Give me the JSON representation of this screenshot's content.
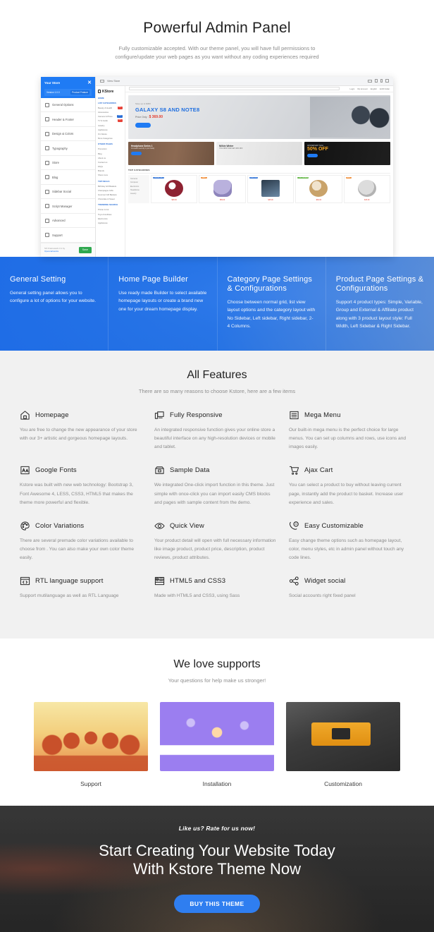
{
  "hero": {
    "title": "Powerful Admin Panel",
    "subtitle_line1": "Fully customizable accepted. With our theme panel, you will have full permissions to",
    "subtitle_line2": "configure/update your web pages as you want without any coding experiences required"
  },
  "admin_shot": {
    "store_selector": "Your Store",
    "close_icon": "close-icon",
    "version": "Version 1.0.0",
    "product_feature_badge": "Product Feature",
    "sidebar_items": [
      {
        "label": "General Options",
        "icon": "home-icon"
      },
      {
        "label": "Header & Footer",
        "icon": "layout-icon"
      },
      {
        "label": "Design & Colors",
        "icon": "palette-icon"
      },
      {
        "label": "Typography",
        "icon": "font-icon"
      },
      {
        "label": "Store",
        "icon": "shop-icon"
      },
      {
        "label": "Blog",
        "icon": "blog-icon"
      },
      {
        "label": "Sidebar Social",
        "icon": "share-icon"
      },
      {
        "label": "Script Manager",
        "icon": "code-icon"
      },
      {
        "label": "Advanced",
        "icon": "wrench-icon"
      },
      {
        "label": "Support",
        "icon": "lifebuoy-icon"
      }
    ],
    "footer_credit_line1": "SO Framework 3.1 by",
    "footer_credit_line2": "Opencartworks",
    "save_label": "Save",
    "preview": {
      "view_store_label": "View Store",
      "devices": [
        "desktop",
        "tablet",
        "mobile",
        "fullscreen"
      ],
      "store_logo": "KStore",
      "nav_home": "HOME",
      "nav_group_categories": "LIST CATEGORIES",
      "nav_group_other": "OTHER PAGES",
      "nav_group_deals": "TOP DEALS",
      "nav_group_trending": "TRENDING SEARCH",
      "categories": [
        {
          "label": "Beauty & Health",
          "tag": "HOT"
        },
        {
          "label": "Accessories",
          "tag": ""
        },
        {
          "label": "Camera & Photo",
          "tag": "NEW"
        },
        {
          "label": "TV & Audio",
          "tag": "HOT"
        },
        {
          "label": "Jewelry",
          "tag": ""
        },
        {
          "label": "Appliances",
          "tag": ""
        },
        {
          "label": "On Nature",
          "tag": ""
        },
        {
          "label": "More Categories",
          "tag": ""
        }
      ],
      "other_pages": [
        "Promotion",
        "Blog",
        "About us",
        "Contact us",
        "FAQs",
        "Brands",
        "Show more"
      ],
      "top_deals": [
        "Birthday Gift Baskets",
        "Champagne Gifts",
        "Gourmet Gift Baskets",
        "Chocolate & Sweet"
      ],
      "trending": [
        "Printer & Ink",
        "Toys & Hobbies",
        "Electronics",
        "Appliances"
      ],
      "top_links": [
        "Login",
        "My Account",
        "English",
        "EUR Dollar"
      ],
      "banner": {
        "kicker": "Save up to $300",
        "title": "GALAXY S8 AND NOTE8",
        "price_label": "Price Only :",
        "price": "$ 369.00",
        "button": "SHOP NOW"
      },
      "promos": [
        {
          "title": "Headphone Series 1",
          "sub": "Innovation security in your family",
          "button": "SHOP NOW"
        },
        {
          "title": "Nillkin Winter",
          "sub": "YOU FIRST AND GET 40% OFF",
          "button": ""
        },
        {
          "title": "ANNIVERSARY SALE",
          "off": "50% OFF",
          "button": "SHOP NOW"
        }
      ],
      "top_categories_label": "TOP CATEGORIES",
      "side_categories": [
        "Cameras",
        "Computer",
        "Electronics",
        "Headphone",
        "Jewelry"
      ],
      "products": [
        {
          "label": "ONLINE ONLY",
          "label_style": "b",
          "price": "$99.00",
          "old": "$120.00"
        },
        {
          "label": "SALE",
          "label_style": "o",
          "price": "$59.00",
          "old": "$80.00"
        },
        {
          "label": "IN STOCK",
          "label_style": "b",
          "price": "$45.00",
          "old": "$60.00"
        },
        {
          "label": "TOP ORDERS",
          "label_style": "g",
          "price": "$60.00",
          "old": "$89.00"
        },
        {
          "label": "SALE",
          "label_style": "o",
          "price": "$33.00",
          "old": "$45.00"
        }
      ]
    }
  },
  "band": {
    "accent": "#1e6eeb",
    "columns": [
      {
        "title": "General Setting",
        "text": "General setting panel allows you to configure a lot of options for your website."
      },
      {
        "title": "Home Page Builder",
        "text": "Use ready made Builder to select available homepage layouts or create a brand new one for your dream homepage display."
      },
      {
        "title": "Category Page Settings & Configurations",
        "text": "Choose between normal grid, list view layout options and the category layout with No Sidebar, Left sidebar, Right sidebar, 2-4 Columns."
      },
      {
        "title": "Product Page Settings & Configurations",
        "text": "Support 4 product types: Simple, Variable, Group and External & Affiliate product along with 3 product layout style: Full Width, Left Sidebar & Right Sidebar."
      }
    ]
  },
  "features": {
    "title": "All Features",
    "subtitle": "There are so many reasons to choose Kstore, here are a few items",
    "items": [
      {
        "icon": "home-icon",
        "title": "Homepage",
        "text": "You are free to change the new appearance of your store with our 3+ artistic and gorgeous homepage layouts."
      },
      {
        "icon": "responsive-devices-icon",
        "title": "Fully Responsive",
        "text": "An integrated responsive function gives your online store a beautiful interface on any high-resolution devices or mobile and tablet."
      },
      {
        "icon": "menu-list-icon",
        "title": "Mega Menu",
        "text": "Our built-in mega menu is the perfect choice for large menus. You can set up columns and rows, use icons and images easily."
      },
      {
        "icon": "font-aa-icon",
        "title": "Google Fonts",
        "text": "Kstore was built with new web technology: Bootstrap 3, Font Awesome 4, LESS, CSS3, HTML5 that makes the theme more powerful and flexible."
      },
      {
        "icon": "archive-box-icon",
        "title": "Sample Data",
        "text": "We integrated One-click import function in this theme. Just simple with once-click you can import easily CMS blocks and pages with sample content from the demo."
      },
      {
        "icon": "shopping-cart-icon",
        "title": "Ajax Cart",
        "text": "You can select a product to buy without leaving current page, instantly add the product to basket. Increase user experience and sales."
      },
      {
        "icon": "color-palette-icon",
        "title": "Color Variations",
        "text": "There are several premade color variations available to choose from . You can also make your own color theme easily."
      },
      {
        "icon": "eye-icon",
        "title": "Quick View",
        "text": "Your product detail will open with full necessary information like image product, product price, description, product reviews, product attributes."
      },
      {
        "icon": "phone-24-icon",
        "title": "Easy Customizable",
        "text": "Easy change theme options such as homepage layout, color, menu styles, etc in admin panel without touch any code lines."
      },
      {
        "icon": "code-window-icon",
        "title": "RTL language support",
        "text": "Support mutilanguage as well as RTL Language"
      },
      {
        "icon": "browser-window-icon",
        "title": "HTML5 and CSS3",
        "text": "Made with HTML5 and CSS3, using Sass"
      },
      {
        "icon": "share-nodes-icon",
        "title": "Widget social",
        "text": "Social accounts right fixed panel"
      }
    ]
  },
  "supports": {
    "title": "We love supports",
    "subtitle": "Your questions for help make us stronger!",
    "items": [
      {
        "caption": "Support",
        "image": "people-holding-hands-illustration"
      },
      {
        "caption": "Installation",
        "image": "person-at-desk-illustration"
      },
      {
        "caption": "Customization",
        "image": "keyboard-customize-key-photo"
      }
    ]
  },
  "cta": {
    "kicker": "Like us? Rate for us now!",
    "heading_line1": "Start Creating Your Website Today",
    "heading_line2": "With Kstore Theme Now",
    "button": "BUY THIS THEME",
    "button_color": "#2f7ef0"
  }
}
